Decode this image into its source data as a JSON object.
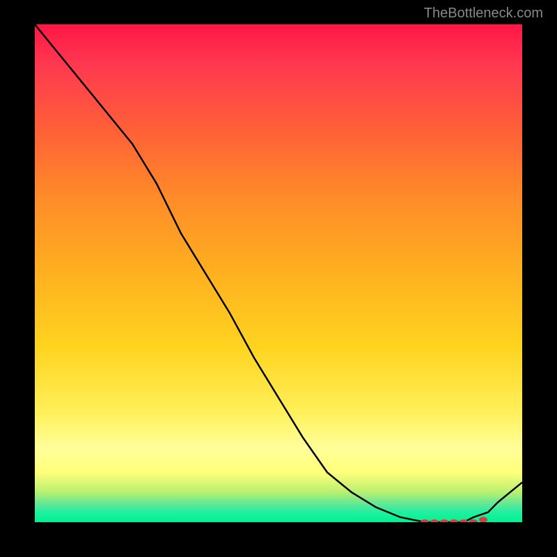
{
  "watermark": "TheBottleneck.com",
  "chart_data": {
    "type": "line",
    "title": "",
    "x": [
      0,
      5,
      10,
      15,
      20,
      25,
      30,
      35,
      40,
      45,
      50,
      55,
      60,
      65,
      70,
      75,
      80,
      82,
      85,
      88,
      90,
      93,
      95,
      100
    ],
    "y": [
      100,
      94,
      88,
      82,
      76,
      68,
      58,
      50,
      42,
      33,
      25,
      17,
      10,
      6,
      3,
      1,
      0,
      0,
      0,
      0,
      1,
      2,
      4,
      8
    ],
    "xlim": [
      0,
      100
    ],
    "ylim": [
      0,
      100
    ],
    "xlabel": "",
    "ylabel": "",
    "markers_x": [
      80,
      82,
      84,
      86,
      88,
      90,
      92
    ],
    "markers_y": [
      0,
      0,
      0,
      0,
      0,
      0,
      0.5
    ]
  },
  "colors": {
    "line": "#000000",
    "marker": "#d04040",
    "background_top": "#ff1744",
    "background_bottom": "#00f090"
  }
}
